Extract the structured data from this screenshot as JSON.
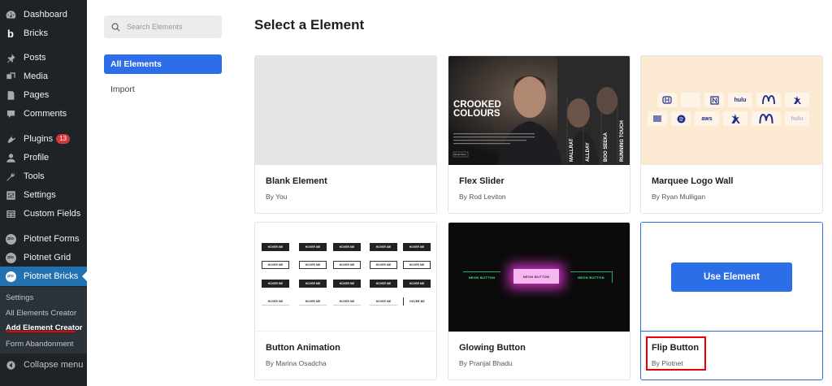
{
  "sidebar": {
    "items": [
      {
        "label": "Dashboard",
        "icon": "dashboard-icon"
      },
      {
        "label": "Bricks",
        "icon": "bricks-icon"
      },
      {
        "label": "Posts",
        "icon": "pin-icon"
      },
      {
        "label": "Media",
        "icon": "media-icon"
      },
      {
        "label": "Pages",
        "icon": "pages-icon"
      },
      {
        "label": "Comments",
        "icon": "comment-icon"
      },
      {
        "label": "Plugins",
        "icon": "plugin-icon",
        "badge": "13"
      },
      {
        "label": "Profile",
        "icon": "user-icon"
      },
      {
        "label": "Tools",
        "icon": "wrench-icon"
      },
      {
        "label": "Settings",
        "icon": "settings-icon"
      },
      {
        "label": "Custom Fields",
        "icon": "fields-icon"
      },
      {
        "label": "Piotnet Forms",
        "icon": "piotnet-icon"
      },
      {
        "label": "Piotnet Grid",
        "icon": "piotnet-icon"
      },
      {
        "label": "Piotnet Bricks",
        "icon": "piotnet-icon"
      }
    ],
    "submenu": [
      "Settings",
      "All Elements Creator",
      "Add Element Creator",
      "Form Abandonment"
    ],
    "collapse": "Collapse menu",
    "piotnet_icon_text": "pio"
  },
  "search": {
    "placeholder": "Search Elements"
  },
  "tabs": {
    "all": "All Elements",
    "import": "Import"
  },
  "heading": "Select a Element",
  "cards": [
    {
      "title": "Blank Element",
      "author": "By You"
    },
    {
      "title": "Flex Slider",
      "author": "By Rod Leviton"
    },
    {
      "title": "Marquee Logo Wall",
      "author": "By Ryan Mulligan"
    },
    {
      "title": "Button Animation",
      "author": "By Marina Osadcha"
    },
    {
      "title": "Glowing Button",
      "author": "By Pranjal Bhadu"
    },
    {
      "title": "Flip Button",
      "author": "By Piotnet"
    }
  ],
  "flex_slider": {
    "headline1": "CROOKED",
    "headline2": "COLOURS",
    "cta": "Read More",
    "tabs": [
      "MALLRAT",
      "ALLDAY",
      "BOO SEEKA",
      "RUNNING TOUCH"
    ]
  },
  "marquee": {
    "logos_row1": [
      "hulu"
    ],
    "logos_row2": [
      "aws",
      "hulu"
    ]
  },
  "button_animation": {
    "label": "HOVER ME"
  },
  "glowing": {
    "left": "NEON BUTTON",
    "center": "NEON BUTTON",
    "right": "NEON BUTTON"
  },
  "use_element": "Use Element",
  "colors": {
    "accent": "#2b6ee8",
    "wp_sidebar": "#1d2327",
    "highlight": "#e00000"
  }
}
